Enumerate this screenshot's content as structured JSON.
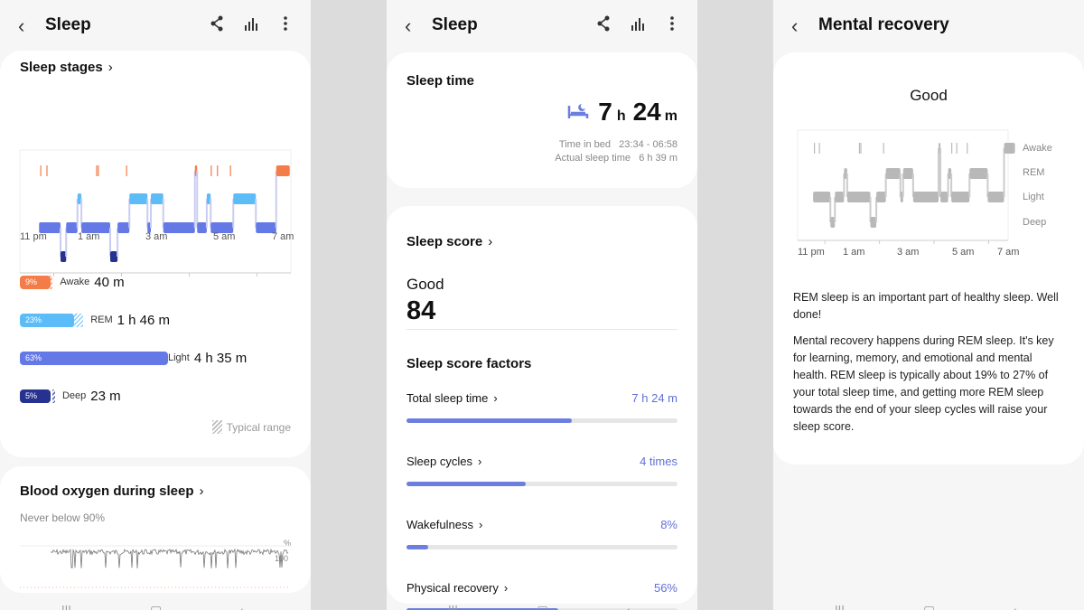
{
  "colors": {
    "awake": "#f47c48",
    "rem": "#5cbcf8",
    "light": "#6478e6",
    "deep": "#27318f",
    "accent": "#5f70d9",
    "gray": "#b8b8b8"
  },
  "panel1": {
    "title": "Sleep",
    "back_icon": "chevron-left",
    "icons": [
      "share-icon",
      "chart-icon",
      "more-icon"
    ],
    "sleep_stages": {
      "title": "Sleep stages",
      "time_labels": [
        "11 pm",
        "1 am",
        "3 am",
        "5 am",
        "7 am"
      ],
      "stages": [
        {
          "name": "Awake",
          "percent": "9%",
          "duration": "40 m",
          "pct": 9,
          "typical": [
            9,
            14
          ]
        },
        {
          "name": "REM",
          "percent": "23%",
          "duration": "1 h 46 m",
          "pct": 23,
          "typical": [
            20,
            27
          ]
        },
        {
          "name": "Light",
          "percent": "63%",
          "duration": "4 h 35 m",
          "pct": 63,
          "typical": [
            50,
            60
          ]
        },
        {
          "name": "Deep",
          "percent": "5%",
          "duration": "23 m",
          "pct": 5,
          "typical": [
            14,
            15
          ]
        }
      ],
      "typical_range": "Typical range"
    },
    "blood_oxygen": {
      "title": "Blood oxygen during sleep",
      "subtitle": "Never below 90%",
      "unit": "%",
      "tick": "100"
    }
  },
  "panel2": {
    "title": "Sleep",
    "sleep_time": {
      "title": "Sleep time",
      "hours": "7",
      "h": "h",
      "minutes": "24",
      "m": "m",
      "time_in_bed_label": "Time in bed",
      "time_in_bed": "23:34 - 06:58",
      "actual_label": "Actual sleep time",
      "actual": "6 h 39 m"
    },
    "sleep_score": {
      "title": "Sleep score",
      "rating": "Good",
      "score": "84",
      "factors_title": "Sleep score factors",
      "factors": [
        {
          "label": "Total sleep time",
          "value": "7 h 24 m",
          "progress": 61
        },
        {
          "label": "Sleep cycles",
          "value": "4 times",
          "progress": 44
        },
        {
          "label": "Wakefulness",
          "value": "8%",
          "progress": 8
        },
        {
          "label": "Physical recovery",
          "value": "56%",
          "progress": 56
        }
      ]
    }
  },
  "panel3": {
    "title": "Mental recovery",
    "rating": "Good",
    "stage_labels": [
      "Awake",
      "REM",
      "Light",
      "Deep"
    ],
    "time_labels": [
      "11 pm",
      "1 am",
      "3 am",
      "5 am",
      "7 am"
    ],
    "para1": "REM sleep is an important part of healthy sleep. Well done!",
    "para2": "Mental recovery happens during REM sleep. It's key for learning, memory, and emotional and mental health. REM sleep is typically about 19% to 27% of your total sleep time, and getting more REM sleep towards the end of your sleep cycles will raise your sleep score."
  },
  "chart_data": {
    "type": "hypnogram",
    "x_range": [
      "23:00",
      "07:00"
    ],
    "levels": [
      "Awake",
      "REM",
      "Light",
      "Deep"
    ],
    "segments": [
      [
        "23:34",
        "00:12",
        "Light"
      ],
      [
        "00:12",
        "00:22",
        "Deep"
      ],
      [
        "00:22",
        "00:42",
        "Light"
      ],
      [
        "00:42",
        "00:49",
        "REM"
      ],
      [
        "00:49",
        "01:40",
        "Light"
      ],
      [
        "01:40",
        "01:53",
        "Deep"
      ],
      [
        "01:53",
        "02:14",
        "Light"
      ],
      [
        "02:14",
        "02:46",
        "REM"
      ],
      [
        "02:46",
        "02:52",
        "Light"
      ],
      [
        "02:52",
        "03:14",
        "REM"
      ],
      [
        "03:14",
        "04:10",
        "Light"
      ],
      [
        "04:10",
        "04:14",
        "Awake"
      ],
      [
        "04:14",
        "04:31",
        "Light"
      ],
      [
        "04:31",
        "04:38",
        "REM"
      ],
      [
        "04:38",
        "05:18",
        "Light"
      ],
      [
        "05:18",
        "05:58",
        "REM"
      ],
      [
        "05:58",
        "06:34",
        "Light"
      ],
      [
        "06:34",
        "06:58",
        "Awake"
      ]
    ],
    "awake_ticks": [
      "23:37",
      "23:48",
      "01:16",
      "01:19",
      "02:09",
      "04:39",
      "04:50",
      "05:13"
    ]
  }
}
